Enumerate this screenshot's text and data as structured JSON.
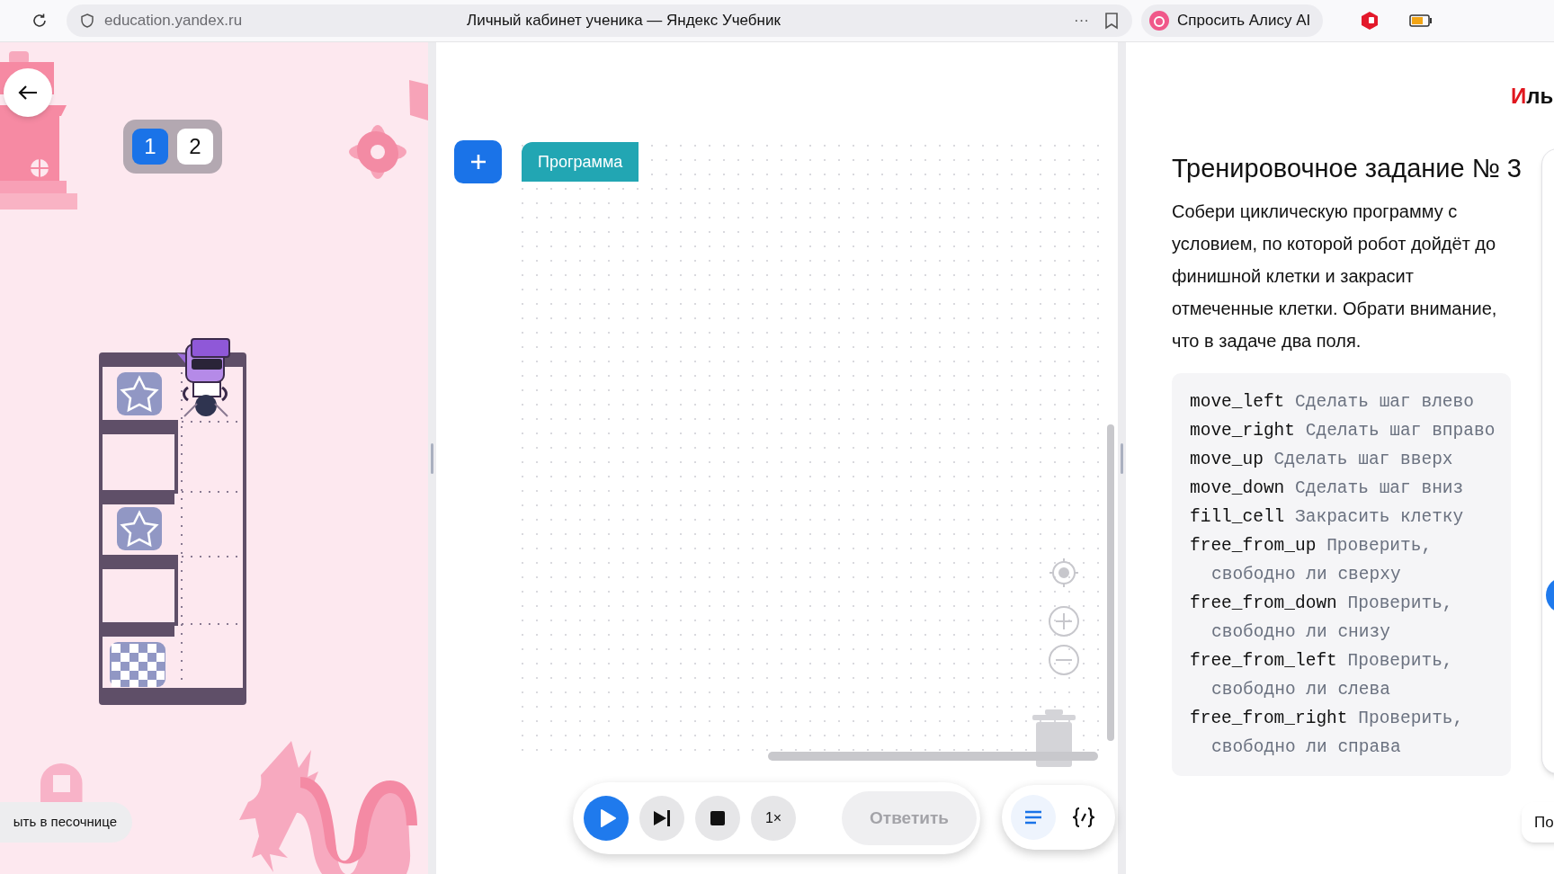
{
  "browser": {
    "url": "education.yandex.ru",
    "title": "Личный кабинет ученика — Яндекс Учебник",
    "more": "···",
    "alice_button": "Спросить Алису AI"
  },
  "field_switch": [
    {
      "label": "1",
      "selected": true
    },
    {
      "label": "2",
      "selected": false
    }
  ],
  "sandbox_button": "ыть в песочнице",
  "workspace": {
    "program_block": "Программа"
  },
  "controls": {
    "speed": "1×",
    "answer_button": "Ответить",
    "view_toggle": [
      {
        "kind": "blocks",
        "selected": true
      },
      {
        "kind": "code",
        "selected": false
      }
    ]
  },
  "user": {
    "name": "Иль"
  },
  "task": {
    "title": "Тренировочное задание № 3",
    "description": "Собери циклическую программу с условием, по которой робот дойдёт до финишной клетки и закрасит отмеченные клетки. Обрати внимание, что в задаче два поля.",
    "commands": [
      {
        "name": "move_left",
        "description": "Сделать шаг влево"
      },
      {
        "name": "move_right",
        "description": "Сделать шаг вправо"
      },
      {
        "name": "move_up",
        "description": "Сделать шаг вверх"
      },
      {
        "name": "move_down",
        "description": "Сделать шаг вниз"
      },
      {
        "name": "fill_cell",
        "description": "Закрасить клетку"
      },
      {
        "name": "free_from_up",
        "description": "Проверить, свободно ли сверху"
      },
      {
        "name": "free_from_down",
        "description": "Проверить, свободно ли снизу"
      },
      {
        "name": "free_from_left",
        "description": "Проверить, свободно ли слева"
      },
      {
        "name": "free_from_right",
        "description": "Проверить, свободно ли справа"
      }
    ]
  },
  "side_button": "По"
}
